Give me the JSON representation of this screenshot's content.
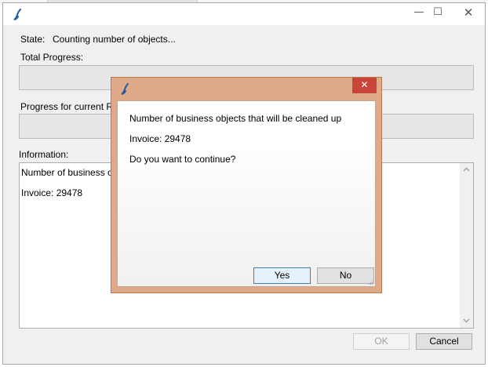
{
  "main_window": {
    "state_label": "State:",
    "state_value": "Counting number of objects...",
    "total_progress_label": "Total Progress:",
    "total_progress_fraction": 0,
    "current_progress_label": "Progress for current Rec",
    "current_progress_fraction": 0,
    "information_label": "Information:",
    "information_lines": [
      "Number of business obje",
      "Invoice: 29478"
    ],
    "ok_label": "OK",
    "cancel_label": "Cancel",
    "minimize_glyph": "—",
    "maximize_glyph": "☐",
    "close_glyph": "✕"
  },
  "dialog": {
    "message_line1": "Number of business objects that will be cleaned up",
    "message_line2": "Invoice: 29478",
    "message_line3": "Do you want to continue?",
    "yes_label": "Yes",
    "no_label": "No",
    "close_glyph": "✕"
  },
  "colors": {
    "dialog_frame": "#e0a98a",
    "dialog_close": "#c9453a",
    "app_icon": "#1f5aa6"
  },
  "icons": {
    "app_icon": "app-logo-icon",
    "scroll_up": "chevron-up-icon",
    "scroll_down": "chevron-down-icon",
    "resize_grip": "resize-grip-icon"
  }
}
